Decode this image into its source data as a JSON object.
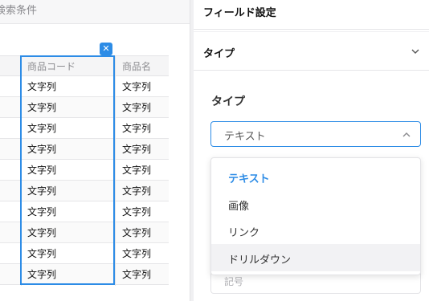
{
  "left_panel": {
    "section_title": "検索条件",
    "table": {
      "columns": [
        "商品コード",
        "商品名"
      ],
      "rows": [
        [
          "文字列",
          "文字列"
        ],
        [
          "文字列",
          "文字列"
        ],
        [
          "文字列",
          "文字列"
        ],
        [
          "文字列",
          "文字列"
        ],
        [
          "文字列",
          "文字列"
        ],
        [
          "文字列",
          "文字列"
        ],
        [
          "文字列",
          "文字列"
        ],
        [
          "文字列",
          "文字列"
        ],
        [
          "文字列",
          "文字列"
        ],
        [
          "文字列",
          "文字列"
        ]
      ],
      "selected_column": "商品コード"
    },
    "remove_column_icon": "close-icon"
  },
  "right_panel": {
    "title": "フィールド設定",
    "section": {
      "label": "タイプ",
      "expanded": true,
      "icon": "chevron-down-icon"
    },
    "type_field": {
      "label": "タイプ",
      "value": "テキスト",
      "icon": "chevron-up-icon",
      "options": [
        {
          "label": "テキスト",
          "selected": true
        },
        {
          "label": "画像",
          "selected": false
        },
        {
          "label": "リンク",
          "selected": false
        },
        {
          "label": "ドリルダウン",
          "selected": false,
          "hovered": true
        }
      ]
    },
    "next_field_placeholder": "記号"
  },
  "colors": {
    "accent": "#2d8ce6",
    "border": "#e3e3e6",
    "header_bg": "#f5f5f6",
    "hover_bg": "#f2f2f4"
  }
}
